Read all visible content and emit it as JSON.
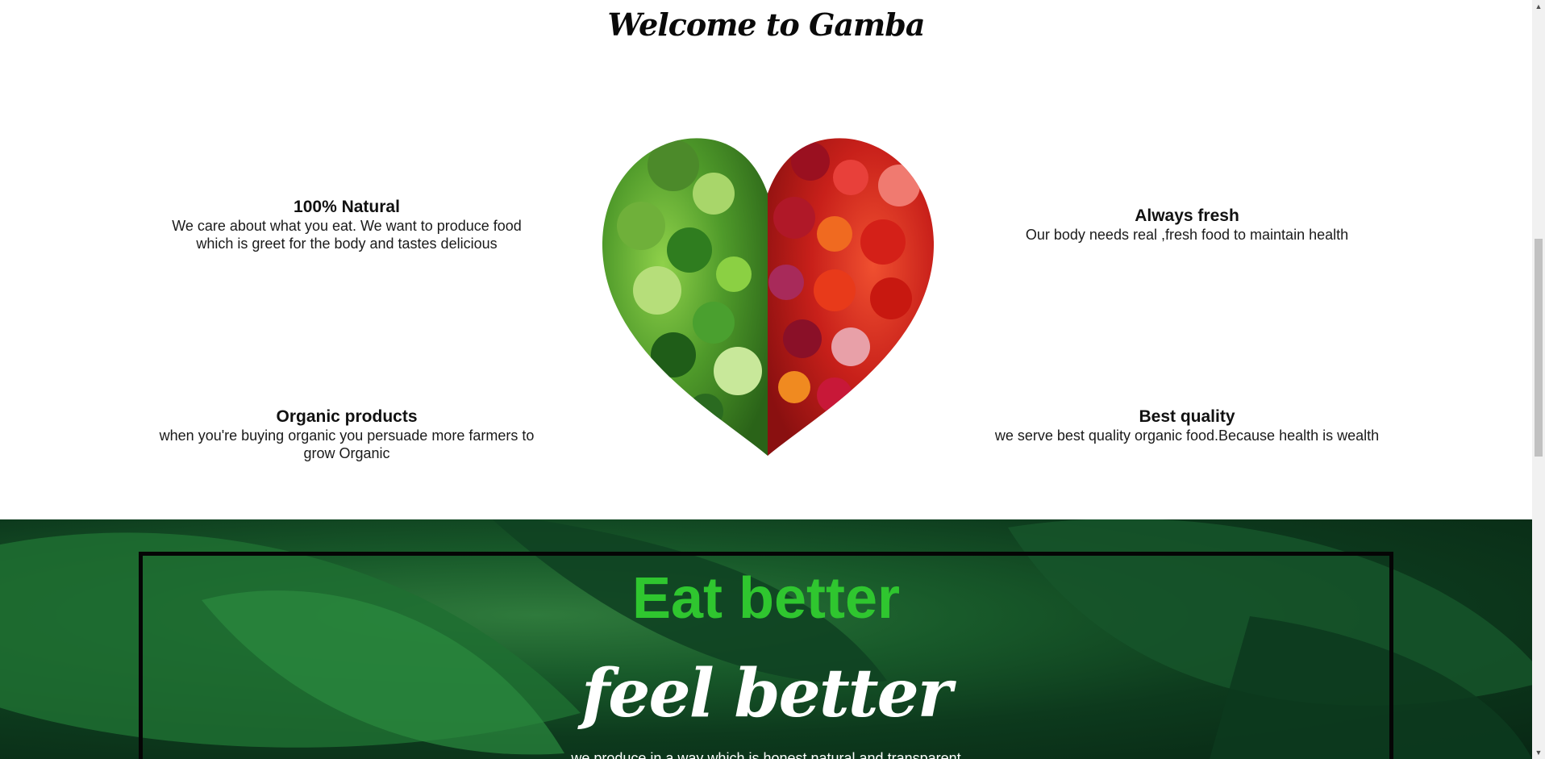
{
  "welcome": {
    "title": "Welcome to Gamba"
  },
  "features": [
    {
      "title": "100% Natural",
      "desc": "We care about what you eat. We want to produce food which is greet for the body and tastes delicious"
    },
    {
      "title": "Always fresh",
      "desc": "Our body needs real ,fresh food to maintain health"
    },
    {
      "title": "Organic products",
      "desc": "when you're buying organic you persuade more farmers to grow Organic"
    },
    {
      "title": "Best quality",
      "desc": "we serve best quality organic food.Because health is wealth"
    }
  ],
  "banner": {
    "headline": "Eat better",
    "subheadline": "feel better",
    "tagline": "we produce in a way which is honest,natural and transparent"
  },
  "colors": {
    "accent_green": "#2fc62f",
    "banner_dark": "#0d3a1d"
  },
  "icons": {
    "scroll_up": "scroll-up-arrow-icon",
    "scroll_down": "scroll-down-arrow-icon"
  }
}
